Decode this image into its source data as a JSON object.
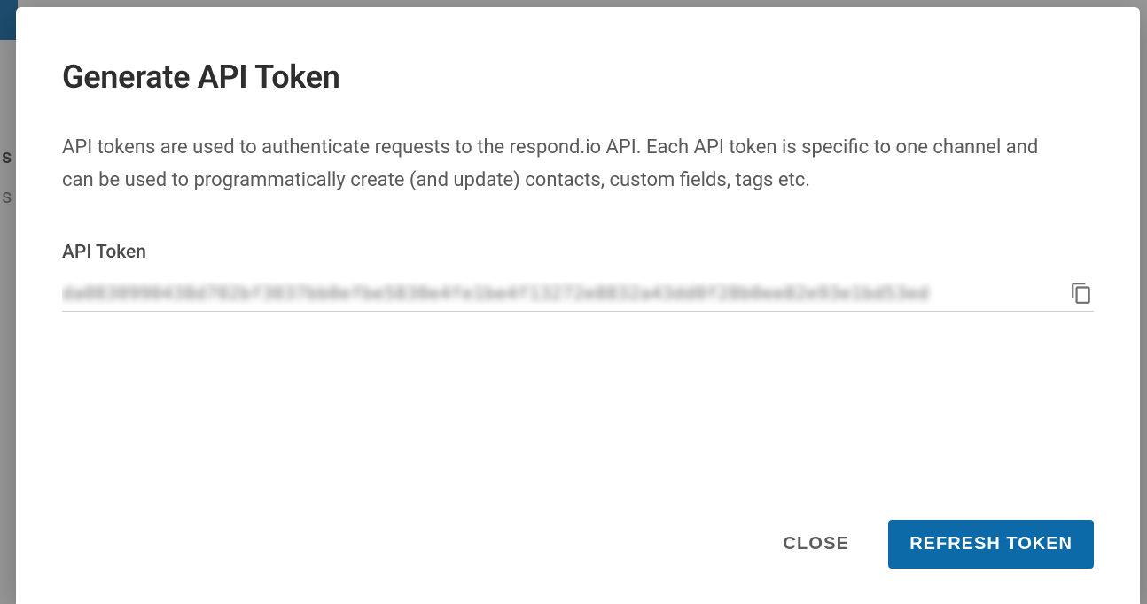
{
  "modal": {
    "title": "Generate API Token",
    "description": "API tokens are used to authenticate requests to the respond.io API. Each API token is specific to one channel and can be used to programmatically create (and update) contacts, custom fields, tags etc.",
    "field_label": "API Token",
    "token_value": "da0830990438d702bf3037bb0efbe5830e4fe1be4f13272e8832a43dd0f28b0ee82e93e1bd53ed",
    "close_label": "CLOSE",
    "refresh_label": "REFRESH TOKEN"
  },
  "colors": {
    "primary": "#0d6aa8"
  }
}
